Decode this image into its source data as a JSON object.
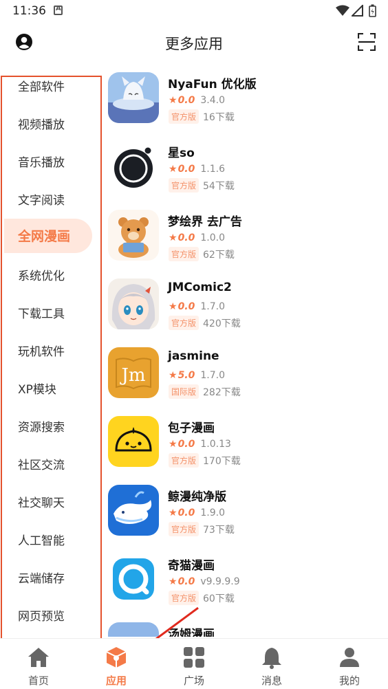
{
  "status": {
    "time": "11:36"
  },
  "header": {
    "title": "更多应用"
  },
  "sidebar": {
    "items": [
      {
        "label": "全部软件"
      },
      {
        "label": "视频播放"
      },
      {
        "label": "音乐播放"
      },
      {
        "label": "文字阅读"
      },
      {
        "label": "全网漫画",
        "active": true
      },
      {
        "label": "系统优化"
      },
      {
        "label": "下载工具"
      },
      {
        "label": "玩机软件"
      },
      {
        "label": "XP模块"
      },
      {
        "label": "资源搜索"
      },
      {
        "label": "社区交流"
      },
      {
        "label": "社交聊天"
      },
      {
        "label": "人工智能"
      },
      {
        "label": "云端储存"
      },
      {
        "label": "网页预览"
      }
    ]
  },
  "apps": [
    {
      "name": "NyaFun 优化版",
      "rating": "0.0",
      "version": "3.4.0",
      "badge": "官方版",
      "downloads": "16下载"
    },
    {
      "name": "星so",
      "rating": "0.0",
      "version": "1.1.6",
      "badge": "官方版",
      "downloads": "54下载"
    },
    {
      "name": "梦绘界 去广告",
      "rating": "0.0",
      "version": "1.0.0",
      "badge": "官方版",
      "downloads": "62下载"
    },
    {
      "name": "JMComic2",
      "rating": "0.0",
      "version": "1.7.0",
      "badge": "官方版",
      "downloads": "420下载"
    },
    {
      "name": "jasmine",
      "rating": "5.0",
      "version": "1.7.0",
      "badge": "国际版",
      "downloads": "282下载"
    },
    {
      "name": "包子漫画",
      "rating": "0.0",
      "version": "1.0.13",
      "badge": "官方版",
      "downloads": "170下载"
    },
    {
      "name": "鲸漫纯净版",
      "rating": "0.0",
      "version": "1.9.0",
      "badge": "官方版",
      "downloads": "73下载"
    },
    {
      "name": "奇猫漫画",
      "rating": "0.0",
      "version": "v9.9.9.9",
      "badge": "官方版",
      "downloads": "60下载"
    },
    {
      "name": "汤姆漫画"
    }
  ],
  "nav": {
    "items": [
      {
        "label": "首页",
        "icon": "home-icon"
      },
      {
        "label": "应用",
        "icon": "apps-cube-icon",
        "active": true
      },
      {
        "label": "广场",
        "icon": "grid-icon"
      },
      {
        "label": "消息",
        "icon": "bell-icon"
      },
      {
        "label": "我的",
        "icon": "person-icon"
      }
    ]
  },
  "colors": {
    "accent": "#f47a48",
    "sidebar_border": "#e4512c",
    "badge_bg": "#fff1ea"
  }
}
